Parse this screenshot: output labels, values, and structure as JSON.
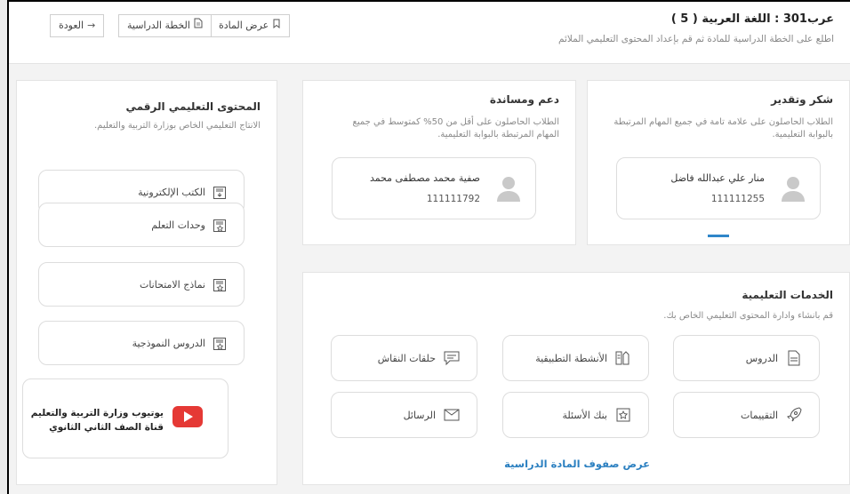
{
  "header": {
    "title": "عرب301 : اللغة العربية ( 5 )",
    "subtitle": "اطلع على الخطة الدراسية للمادة ثم قم بإعداد المحتوى التعليمي الملائم",
    "buttons": {
      "view_subject": "عرض المادة",
      "study_plan": "الخطة الدراسية",
      "back": "العودة"
    }
  },
  "thanks": {
    "title": "شكر وتقدير",
    "description": "الطلاب الحاصلون على علامة تامة في جميع المهام المرتبطة بالبوابة التعليمية.",
    "student": {
      "name": "منار علي عبدالله فاضل",
      "id": "111111255"
    }
  },
  "support": {
    "title": "دعم ومساندة",
    "description": "الطلاب الحاصلون على أقل من 50% كمتوسط في جميع المهام المرتبطة بالبوابة التعليمية.",
    "student": {
      "name": "صفية محمد مصطفى محمد",
      "id": "111111792"
    }
  },
  "digital": {
    "title": "المحتوى التعليمي الرقمي",
    "description": "الانتاج التعليمي الخاص بوزارة التربية والتعليم.",
    "items": [
      {
        "label": "الكتب الإلكترونية",
        "icon": "ebook-icon"
      },
      {
        "label": "وحدات التعلم",
        "icon": "learning-units-icon"
      },
      {
        "label": "نماذج الامتحانات",
        "icon": "exam-models-icon"
      },
      {
        "label": "الدروس النموذجية",
        "icon": "model-lessons-icon"
      }
    ],
    "youtube": {
      "line1": "يوتيوب وزارة التربية والتعليم",
      "line2": "قناة الصف الثاني الثانوي",
      "color": "#e53935"
    }
  },
  "services": {
    "title": "الخدمات التعليمية",
    "description": "قم بانشاء وادارة المحتوى التعليمي الخاص بك.",
    "items": [
      {
        "label": "الدروس",
        "icon": "lessons-icon"
      },
      {
        "label": "الأنشطة التطبيقية",
        "icon": "activities-icon"
      },
      {
        "label": "حلقات النقاش",
        "icon": "discussion-icon"
      },
      {
        "label": "التقييمات",
        "icon": "assessments-icon"
      },
      {
        "label": "بنك الأسئلة",
        "icon": "question-bank-icon"
      },
      {
        "label": "الرسائل",
        "icon": "messages-icon"
      }
    ],
    "link": "عرض صفوف المادة الدراسية"
  },
  "colors": {
    "accent": "#2a7fc0",
    "youtube": "#e53935"
  }
}
